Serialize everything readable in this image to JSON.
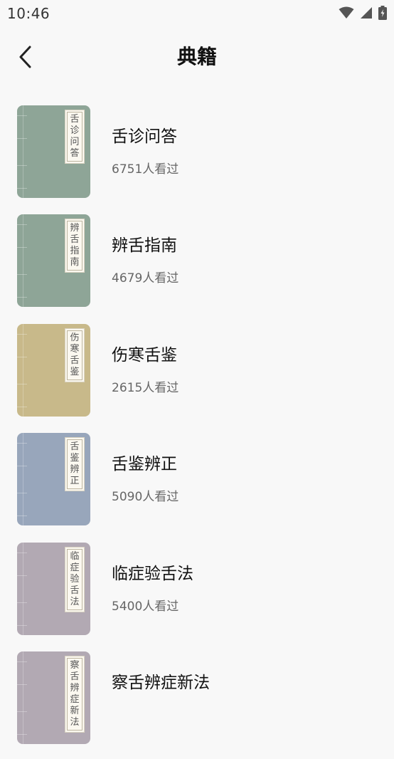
{
  "status_bar": {
    "time": "10:46",
    "icons": [
      "wifi-icon",
      "signal-icon",
      "battery-icon"
    ]
  },
  "header": {
    "back_icon": "chevron-left-icon",
    "title": "典籍"
  },
  "books": [
    {
      "title": "舌诊问答",
      "views": "6751人看过",
      "cover_color": "#8ea597"
    },
    {
      "title": "辨舌指南",
      "views": "4679人看过",
      "cover_color": "#8ea597"
    },
    {
      "title": "伤寒舌鉴",
      "views": "2615人看过",
      "cover_color": "#c8b98a"
    },
    {
      "title": "舌鉴辨正",
      "views": "5090人看过",
      "cover_color": "#98a6bb"
    },
    {
      "title": "临症验舌法",
      "views": "5400人看过",
      "cover_color": "#b2a9b3"
    },
    {
      "title": "察舌辨症新法",
      "views": "",
      "cover_color": "#b2a9b3"
    }
  ],
  "colors": {
    "background": "#f8f8f8",
    "title_text": "#111111",
    "secondary_text": "#666666"
  }
}
